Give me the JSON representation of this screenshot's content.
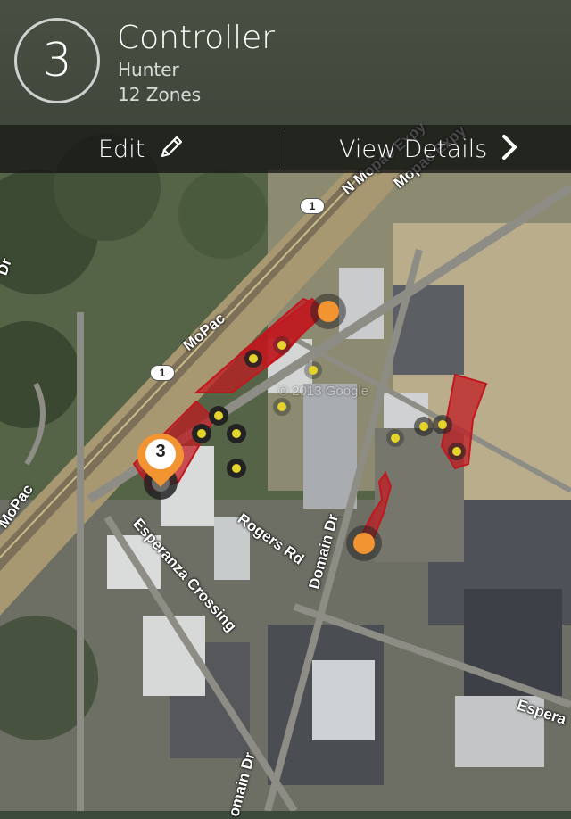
{
  "header": {
    "controller_number": "3",
    "title": "Controller",
    "brand": "Hunter",
    "zones": "12 Zones"
  },
  "actions": {
    "edit_label": "Edit",
    "view_details_label": "View Details"
  },
  "map": {
    "roads": {
      "mopac_1": "MoPac",
      "mopac_2": "MoPac",
      "n_mopac_expy": "N Mopac Expy",
      "mopac_expy": "Mopac Expy",
      "esperanza_crossing": "Esperanza Crossing",
      "rogers_rd": "Rogers Rd",
      "domain_dr": "Domain Dr",
      "domain_dr_2": "omain Dr",
      "espera": "Espera",
      "dr": "Dr",
      "route_1": "1",
      "route_1b": "1",
      "watermark": "© 2013 Google"
    },
    "marker_label": "3",
    "colors": {
      "zone_fill": "#c0181f",
      "zone_point": "#e4d32a",
      "valve": "#f29431",
      "controller_pin": "#f29431"
    }
  }
}
